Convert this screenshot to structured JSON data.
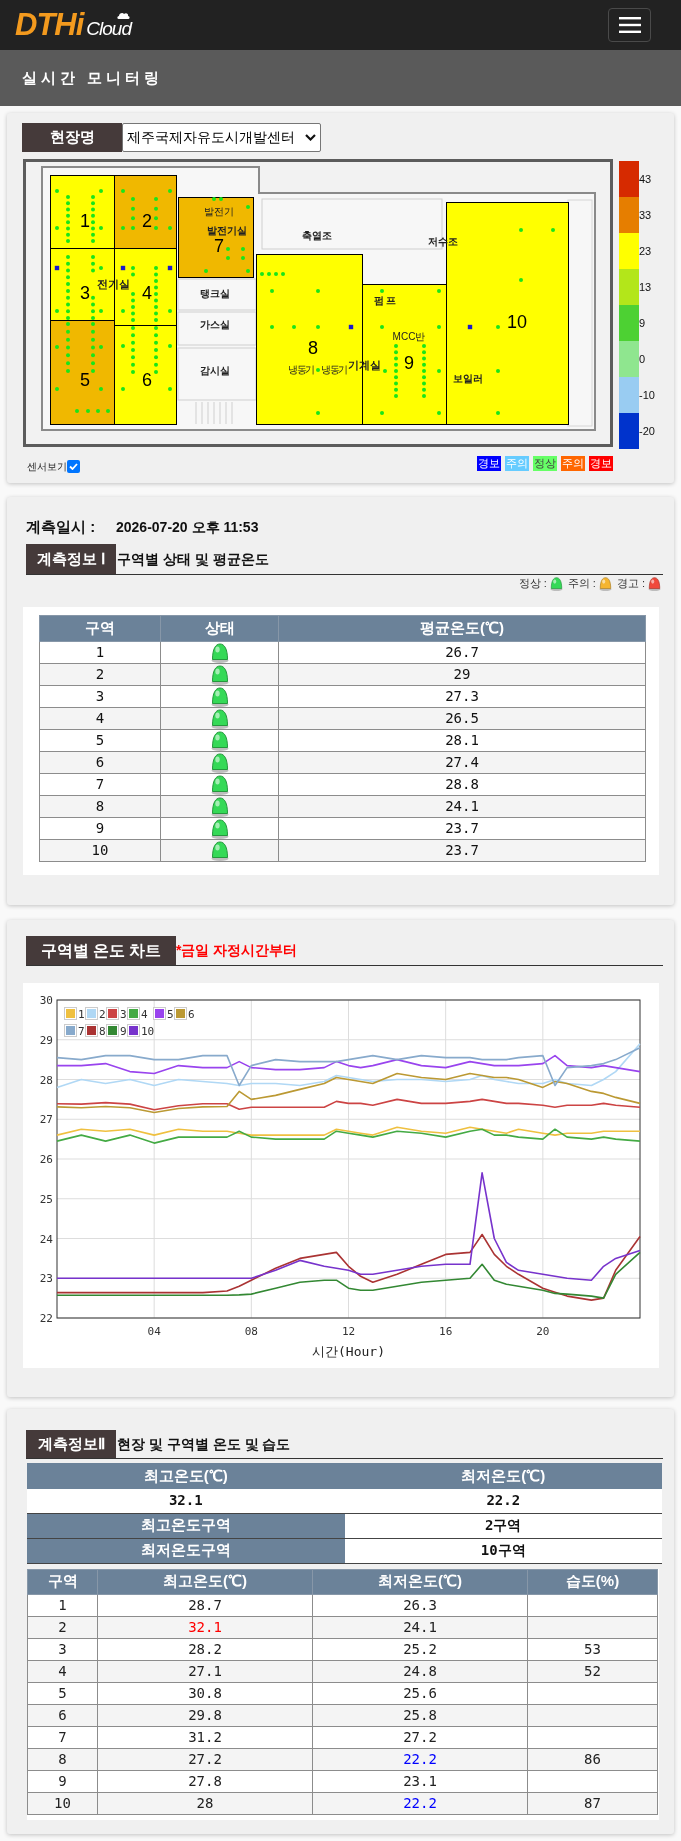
{
  "header": {
    "logo": {
      "brand": "DTHi",
      "suffix": "Cloud"
    }
  },
  "page_title": "실시간 모니터링",
  "site": {
    "label": "현장명",
    "value": "제주국제자유도시개발센터"
  },
  "floor_plan": {
    "zones": [
      {
        "label": "1",
        "color": "#ffff00"
      },
      {
        "label": "2",
        "color": "#f0b800"
      },
      {
        "label": "3",
        "color": "#ffff00"
      },
      {
        "label": "4",
        "color": "#ffff00"
      },
      {
        "label": "5",
        "color": "#f0b800"
      },
      {
        "label": "6",
        "color": "#ffff00"
      },
      {
        "label": "7",
        "color": "#f0b800"
      },
      {
        "label": "8",
        "color": "#ffff00"
      },
      {
        "label": "9",
        "color": "#ffff00"
      },
      {
        "label": "10",
        "color": "#ffff00"
      }
    ],
    "rooms": [
      "발전기",
      "발전기실",
      "축열조",
      "저수조",
      "전기실",
      "탱크실",
      "펌 프",
      "가스실",
      "MCC반",
      "감시실",
      "냉동기",
      "냉동기",
      "기계실",
      "보일러"
    ]
  },
  "color_scale": [
    {
      "label": "43",
      "color": "#d62a00"
    },
    {
      "label": "33",
      "color": "#e67e00"
    },
    {
      "label": "23",
      "color": "#ffff00"
    },
    {
      "label": "13",
      "color": "#b3e61a"
    },
    {
      "label": "9",
      "color": "#4dd133"
    },
    {
      "label": "0",
      "color": "#8fe68f"
    },
    {
      "label": "-10",
      "color": "#99ccf2"
    },
    {
      "label": "-20",
      "color": "#0033cc"
    }
  ],
  "sensor_toggle": {
    "label": "센서보기",
    "checked": true
  },
  "status_legend": [
    {
      "label": "경보",
      "color": "#0000ff"
    },
    {
      "label": "주의",
      "color": "#66ccff"
    },
    {
      "label": "정상",
      "color": "#66ff66"
    },
    {
      "label": "주의",
      "color": "#ff6600"
    },
    {
      "label": "경보",
      "color": "#ff0000"
    }
  ],
  "measurement": {
    "label": "계측일시 :",
    "value": "2026-07-20 오후 11:53"
  },
  "info1": {
    "tag": "계측정보 Ⅰ",
    "title": "구역별 상태 및 평균온도",
    "legend": [
      {
        "label": "정상 :",
        "color": "#35d957"
      },
      {
        "label": "주의 :",
        "color": "#f5b530"
      },
      {
        "label": "경고 :",
        "color": "#f0493b"
      }
    ],
    "table": {
      "columns": [
        "구역",
        "상태",
        "평균온도(℃)"
      ],
      "rows": [
        {
          "zone": "1",
          "color": "#35d957",
          "average": "26.7"
        },
        {
          "zone": "2",
          "color": "#35d957",
          "average": "29"
        },
        {
          "zone": "3",
          "color": "#35d957",
          "average": "27.3"
        },
        {
          "zone": "4",
          "color": "#35d957",
          "average": "26.5"
        },
        {
          "zone": "5",
          "color": "#35d957",
          "average": "28.1"
        },
        {
          "zone": "6",
          "color": "#35d957",
          "average": "27.4"
        },
        {
          "zone": "7",
          "color": "#35d957",
          "average": "28.8"
        },
        {
          "zone": "8",
          "color": "#35d957",
          "average": "24.1"
        },
        {
          "zone": "9",
          "color": "#35d957",
          "average": "23.7"
        },
        {
          "zone": "10",
          "color": "#35d957",
          "average": "23.7"
        }
      ]
    }
  },
  "chart_section": {
    "tag": "구역별 온도 차트",
    "note": "*금일 자정시간부터",
    "chart_data": {
      "type": "line",
      "xlabel": "시간(Hour)",
      "x": [
        0,
        1,
        2,
        3,
        4,
        5,
        6,
        7,
        7.5,
        8,
        9,
        10,
        11,
        11.5,
        12,
        12.5,
        13,
        14,
        15,
        16,
        17,
        17.5,
        18,
        18.5,
        19,
        20,
        20.5,
        21,
        22,
        22.5,
        23,
        24
      ],
      "xlim": [
        0,
        24
      ],
      "ylim": [
        22,
        30
      ],
      "xticks": [
        {
          "value": 4,
          "label": "04"
        },
        {
          "value": 8,
          "label": "08"
        },
        {
          "value": 12,
          "label": "12"
        },
        {
          "value": 16,
          "label": "16"
        },
        {
          "value": 20,
          "label": "20"
        }
      ],
      "yticks": [
        22,
        23,
        24,
        25,
        26,
        27,
        28,
        29,
        30
      ],
      "grid": true,
      "legend": "upper left",
      "series": [
        {
          "name": "1",
          "color": "#efc040",
          "values": [
            26.6,
            26.75,
            26.7,
            26.75,
            26.6,
            26.75,
            26.7,
            26.7,
            26.65,
            26.6,
            26.6,
            26.6,
            26.6,
            26.75,
            26.7,
            26.65,
            26.6,
            26.8,
            26.7,
            26.65,
            26.8,
            26.75,
            26.7,
            26.65,
            26.75,
            26.65,
            26.6,
            26.65,
            26.65,
            26.7,
            26.7,
            26.7
          ]
        },
        {
          "name": "2",
          "color": "#b0d8f5",
          "values": [
            27.8,
            28.0,
            27.9,
            28.0,
            27.85,
            28.0,
            27.95,
            27.9,
            27.85,
            27.9,
            27.9,
            27.85,
            27.95,
            28.1,
            28.05,
            28.0,
            27.95,
            28.0,
            28.0,
            27.95,
            28.0,
            28.1,
            28.0,
            27.95,
            27.9,
            27.9,
            28.0,
            27.9,
            27.85,
            28.0,
            28.2,
            28.9
          ]
        },
        {
          "name": "3",
          "color": "#cc4444",
          "values": [
            27.39,
            27.38,
            27.42,
            27.38,
            27.24,
            27.34,
            27.39,
            27.39,
            27.25,
            27.3,
            27.3,
            27.3,
            27.3,
            27.45,
            27.4,
            27.4,
            27.35,
            27.5,
            27.4,
            27.4,
            27.45,
            27.5,
            27.45,
            27.4,
            27.4,
            27.35,
            27.3,
            27.35,
            27.35,
            27.4,
            27.35,
            27.3
          ]
        },
        {
          "name": "4",
          "color": "#44aa44",
          "values": [
            26.45,
            26.6,
            26.45,
            26.6,
            26.4,
            26.55,
            26.55,
            26.55,
            26.7,
            26.55,
            26.5,
            26.5,
            26.5,
            26.7,
            26.65,
            26.6,
            26.55,
            26.7,
            26.65,
            26.55,
            26.7,
            26.75,
            26.6,
            26.6,
            26.55,
            26.5,
            26.75,
            26.55,
            26.5,
            26.55,
            26.5,
            26.45
          ]
        },
        {
          "name": "5",
          "color": "#9944ee",
          "values": [
            28.35,
            28.35,
            28.4,
            28.2,
            28.15,
            28.35,
            28.3,
            28.3,
            28.45,
            28.3,
            28.25,
            28.25,
            28.3,
            28.45,
            28.35,
            28.3,
            28.35,
            28.5,
            28.35,
            28.3,
            28.45,
            28.4,
            28.35,
            28.35,
            28.35,
            28.4,
            28.6,
            28.35,
            28.3,
            28.35,
            28.3,
            28.2
          ]
        },
        {
          "name": "6",
          "color": "#bb9933",
          "values": [
            27.31,
            27.29,
            27.32,
            27.29,
            27.17,
            27.27,
            27.31,
            27.32,
            27.7,
            27.5,
            27.6,
            27.75,
            27.9,
            28.05,
            28.0,
            27.95,
            27.9,
            28.15,
            28.05,
            28.0,
            28.15,
            28.1,
            28.05,
            28.05,
            28.0,
            27.8,
            27.95,
            27.9,
            27.7,
            27.65,
            27.55,
            27.4
          ]
        },
        {
          "name": "7",
          "color": "#88aacc",
          "values": [
            28.55,
            28.5,
            28.6,
            28.6,
            28.5,
            28.5,
            28.6,
            28.6,
            27.85,
            28.35,
            28.5,
            28.45,
            28.45,
            28.45,
            28.5,
            28.55,
            28.6,
            28.5,
            28.6,
            28.55,
            28.55,
            28.5,
            28.5,
            28.5,
            28.55,
            28.6,
            27.85,
            28.3,
            28.35,
            28.4,
            28.5,
            28.8
          ]
        },
        {
          "name": "8",
          "color": "#aa3333",
          "values": [
            22.64,
            22.64,
            22.64,
            22.64,
            22.64,
            22.64,
            22.64,
            22.68,
            22.8,
            22.95,
            23.25,
            23.5,
            23.6,
            23.65,
            23.3,
            23.05,
            22.9,
            23.1,
            23.35,
            23.6,
            23.65,
            24.1,
            23.6,
            23.3,
            23.1,
            22.75,
            22.65,
            22.55,
            22.45,
            22.5,
            23.2,
            24.05
          ]
        },
        {
          "name": "9",
          "color": "#338833",
          "values": [
            22.57,
            22.57,
            22.57,
            22.57,
            22.57,
            22.57,
            22.57,
            22.57,
            22.58,
            22.6,
            22.75,
            22.9,
            22.95,
            22.95,
            22.75,
            22.7,
            22.7,
            22.8,
            22.9,
            22.95,
            23.0,
            23.35,
            22.95,
            22.85,
            22.8,
            22.7,
            22.62,
            22.6,
            22.55,
            22.5,
            23.1,
            23.65
          ]
        },
        {
          "name": "10",
          "color": "#7733cc",
          "values": [
            23.0,
            23.0,
            23.0,
            23.0,
            23.0,
            23.0,
            23.0,
            23.0,
            23.0,
            23.0,
            23.2,
            23.45,
            23.3,
            23.25,
            23.2,
            23.1,
            23.1,
            23.2,
            23.3,
            23.35,
            23.35,
            25.65,
            24.0,
            23.4,
            23.2,
            23.1,
            23.05,
            23.0,
            22.95,
            23.3,
            23.5,
            23.7
          ]
        }
      ]
    }
  },
  "info2": {
    "tag": "계측정보Ⅱ",
    "title": "현장 및 구역별 온도 및 습도",
    "summary": {
      "columns": [
        "최고온도(℃)",
        "최저온도(℃)"
      ],
      "values": [
        "32.1",
        "22.2"
      ],
      "rows": [
        {
          "label": "최고온도구역",
          "value": "2구역"
        },
        {
          "label": "최저온도구역",
          "value": "10구역"
        }
      ]
    },
    "table": {
      "columns": [
        "구역",
        "최고온도(℃)",
        "최저온도(℃)",
        "습도(%)"
      ],
      "rows": [
        {
          "zone": "1",
          "max": "28.7",
          "min": "26.3",
          "highest": false,
          "lowest": false
        },
        {
          "zone": "2",
          "max": "32.1",
          "min": "24.1",
          "highest": true,
          "lowest": false
        },
        {
          "zone": "3",
          "max": "28.2",
          "min": "25.2",
          "humidity": "53",
          "highest": false,
          "lowest": false
        },
        {
          "zone": "4",
          "max": "27.1",
          "min": "24.8",
          "humidity": "52",
          "highest": false,
          "lowest": false
        },
        {
          "zone": "5",
          "max": "30.8",
          "min": "25.6",
          "highest": false,
          "lowest": false
        },
        {
          "zone": "6",
          "max": "29.8",
          "min": "25.8",
          "highest": false,
          "lowest": false
        },
        {
          "zone": "7",
          "max": "31.2",
          "min": "27.2",
          "highest": false,
          "lowest": false
        },
        {
          "zone": "8",
          "max": "27.2",
          "min": "22.2",
          "humidity": "86",
          "highest": false,
          "lowest": true
        },
        {
          "zone": "9",
          "max": "27.8",
          "min": "23.1",
          "highest": false,
          "lowest": false
        },
        {
          "zone": "10",
          "max": "28",
          "min": "22.2",
          "humidity": "87",
          "highest": false,
          "lowest": true
        }
      ]
    }
  }
}
